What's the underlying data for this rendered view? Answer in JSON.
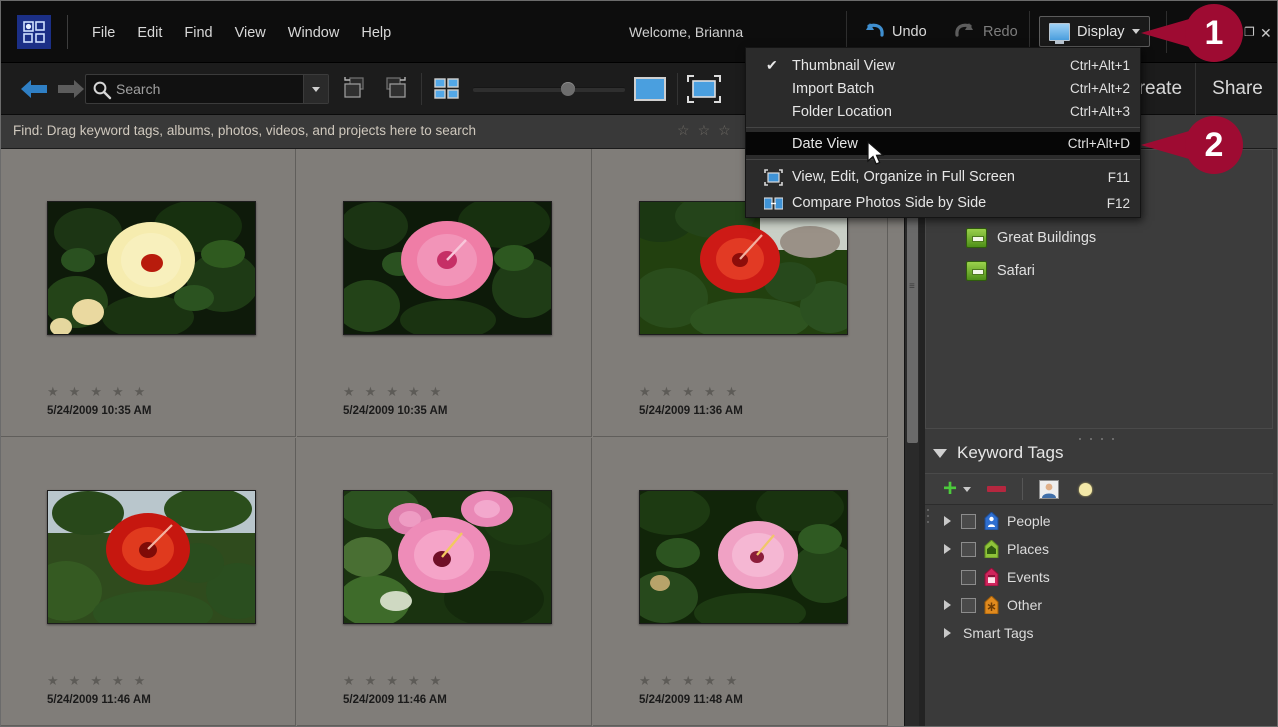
{
  "app": {
    "logo_icon": "photo-organizer-logo-icon",
    "welcome": "Welcome, Brianna",
    "window_restore": "❐",
    "window_close": "✕"
  },
  "menubar": {
    "items": [
      {
        "label": "File"
      },
      {
        "label": "Edit"
      },
      {
        "label": "Find"
      },
      {
        "label": "View"
      },
      {
        "label": "Window"
      },
      {
        "label": "Help"
      }
    ],
    "undo_label": "Undo",
    "redo_label": "Redo",
    "display_label": "Display"
  },
  "toolbar": {
    "search_placeholder": "Search",
    "search_value": "",
    "create_label": "Create",
    "share_label": "Share",
    "zoom_percent": 58,
    "icons": [
      "back-arrow-icon",
      "forward-arrow-icon",
      "search-icon",
      "search-dropdown-caret-icon",
      "rotate-left-icon",
      "rotate-right-icon",
      "grid-view-icon",
      "single-photo-view-icon",
      "full-screen-view-icon"
    ]
  },
  "findbar": {
    "text": "Find: Drag keyword tags, albums, photos, videos, and projects here to search",
    "stars": [
      "☆",
      "☆",
      "☆"
    ]
  },
  "display_menu": {
    "groups": [
      {
        "items": [
          {
            "label": "Thumbnail View",
            "shortcut": "Ctrl+Alt+1",
            "checked": true,
            "selected": false,
            "icon": ""
          },
          {
            "label": "Import Batch",
            "shortcut": "Ctrl+Alt+2",
            "checked": false,
            "selected": false,
            "icon": ""
          },
          {
            "label": "Folder Location",
            "shortcut": "Ctrl+Alt+3",
            "checked": false,
            "selected": false,
            "icon": ""
          }
        ]
      },
      {
        "items": [
          {
            "label": "Date View",
            "shortcut": "Ctrl+Alt+D",
            "checked": false,
            "selected": true,
            "icon": ""
          }
        ]
      },
      {
        "items": [
          {
            "label": "View, Edit, Organize in Full Screen",
            "shortcut": "F11",
            "checked": false,
            "selected": false,
            "icon": "full-screen-icon"
          },
          {
            "label": "Compare Photos Side by Side",
            "shortcut": "F12",
            "checked": false,
            "selected": false,
            "icon": "compare-side-by-side-icon"
          }
        ]
      }
    ]
  },
  "photo_grid": {
    "photos": [
      {
        "caption": "5/24/2009 10:35 AM",
        "rating": 0,
        "alt": "yellow-hibiscus-flower"
      },
      {
        "caption": "5/24/2009 10:35 AM",
        "rating": 0,
        "alt": "pink-hibiscus-flower"
      },
      {
        "caption": "5/24/2009 11:36 AM",
        "rating": 0,
        "alt": "red-hibiscus-flower"
      },
      {
        "caption": "5/24/2009 11:46 AM",
        "rating": 0,
        "alt": "red-hibiscus-flower-sky"
      },
      {
        "caption": "5/24/2009 11:46 AM",
        "rating": 0,
        "alt": "pink-hibiscus-flowers-bush"
      },
      {
        "caption": "5/24/2009 11:48 AM",
        "rating": 0,
        "alt": "light-pink-hibiscus-flower"
      }
    ],
    "star_glyph": "★"
  },
  "right_panel": {
    "albums": [
      {
        "label": "Great Buildings",
        "icon": "album-icon"
      },
      {
        "label": "Safari",
        "icon": "album-icon"
      }
    ],
    "keyword_tags": {
      "title": "Keyword Tags",
      "toolbar_icons": [
        "add-tag-icon",
        "add-tag-caret-icon",
        "remove-tag-icon",
        "people-recognition-icon",
        "suggestion-bulb-icon"
      ],
      "rows": [
        {
          "label": "People",
          "expandable": true,
          "checkbox": true,
          "tag_color": "#2f6fd0"
        },
        {
          "label": "Places",
          "expandable": true,
          "checkbox": true,
          "tag_color": "#8fc43a"
        },
        {
          "label": "Events",
          "expandable": false,
          "checkbox": true,
          "tag_color": "#d0245c"
        },
        {
          "label": "Other",
          "expandable": true,
          "checkbox": true,
          "tag_color": "#e08a1e"
        },
        {
          "label": "Smart Tags",
          "expandable": true,
          "checkbox": false,
          "tag_color": ""
        }
      ]
    }
  },
  "callouts": [
    {
      "number": "1"
    },
    {
      "number": "2"
    }
  ],
  "colors": {
    "accent": "#9e0b32",
    "menubar_bg": "#0d0d0d",
    "toolbar_bg": "#1c1c1c",
    "grid_bg": "#807d79",
    "panel_bg": "#3a3a3a",
    "selection_bg": "#060606"
  }
}
